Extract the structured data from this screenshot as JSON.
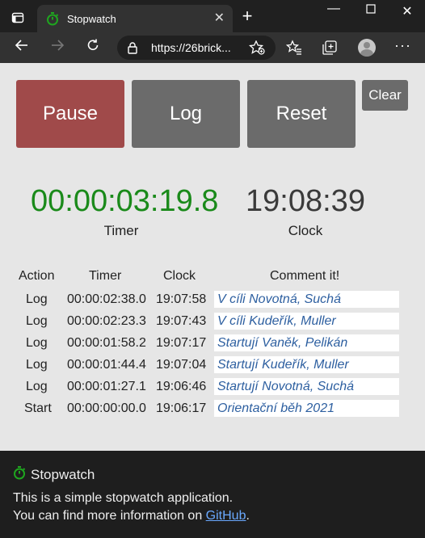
{
  "browser": {
    "tab_title": "Stopwatch",
    "url": "https://26brick...",
    "new_tab": "+",
    "close_tab": "✕"
  },
  "buttons": {
    "pause": "Pause",
    "log": "Log",
    "reset": "Reset",
    "clear": "Clear"
  },
  "timer": {
    "value": "00:00:03:19.8",
    "label": "Timer"
  },
  "clock": {
    "value": "19:08:39",
    "label": "Clock"
  },
  "table": {
    "headers": {
      "action": "Action",
      "timer": "Timer",
      "clock": "Clock",
      "comment": "Comment it!"
    },
    "rows": [
      {
        "action": "Log",
        "timer": "00:00:02:38.0",
        "clock": "19:07:58",
        "comment": "V cíli Novotná, Suchá"
      },
      {
        "action": "Log",
        "timer": "00:00:02:23.3",
        "clock": "19:07:43",
        "comment": "V cíli Kudeřík, Muller"
      },
      {
        "action": "Log",
        "timer": "00:00:01:58.2",
        "clock": "19:07:17",
        "comment": "Startují Vaněk, Pelikán"
      },
      {
        "action": "Log",
        "timer": "00:00:01:44.4",
        "clock": "19:07:04",
        "comment": "Startují Kudeřík, Muller"
      },
      {
        "action": "Log",
        "timer": "00:00:01:27.1",
        "clock": "19:06:46",
        "comment": "Startují Novotná, Suchá"
      },
      {
        "action": "Start",
        "timer": "00:00:00:00.0",
        "clock": "19:06:17",
        "comment": "Orientační běh 2021"
      }
    ]
  },
  "footer": {
    "title": "Stopwatch",
    "line1": "This is a simple stopwatch application.",
    "line2_prefix": "You can find more information on ",
    "link": "GitHub",
    "line2_suffix": "."
  },
  "colors": {
    "pause": "#a04a4a",
    "neutral_button": "#6b6b6b",
    "timer": "#1a8a1a",
    "comment_text": "#2d5fa0",
    "icon_green": "#1fa51f"
  }
}
